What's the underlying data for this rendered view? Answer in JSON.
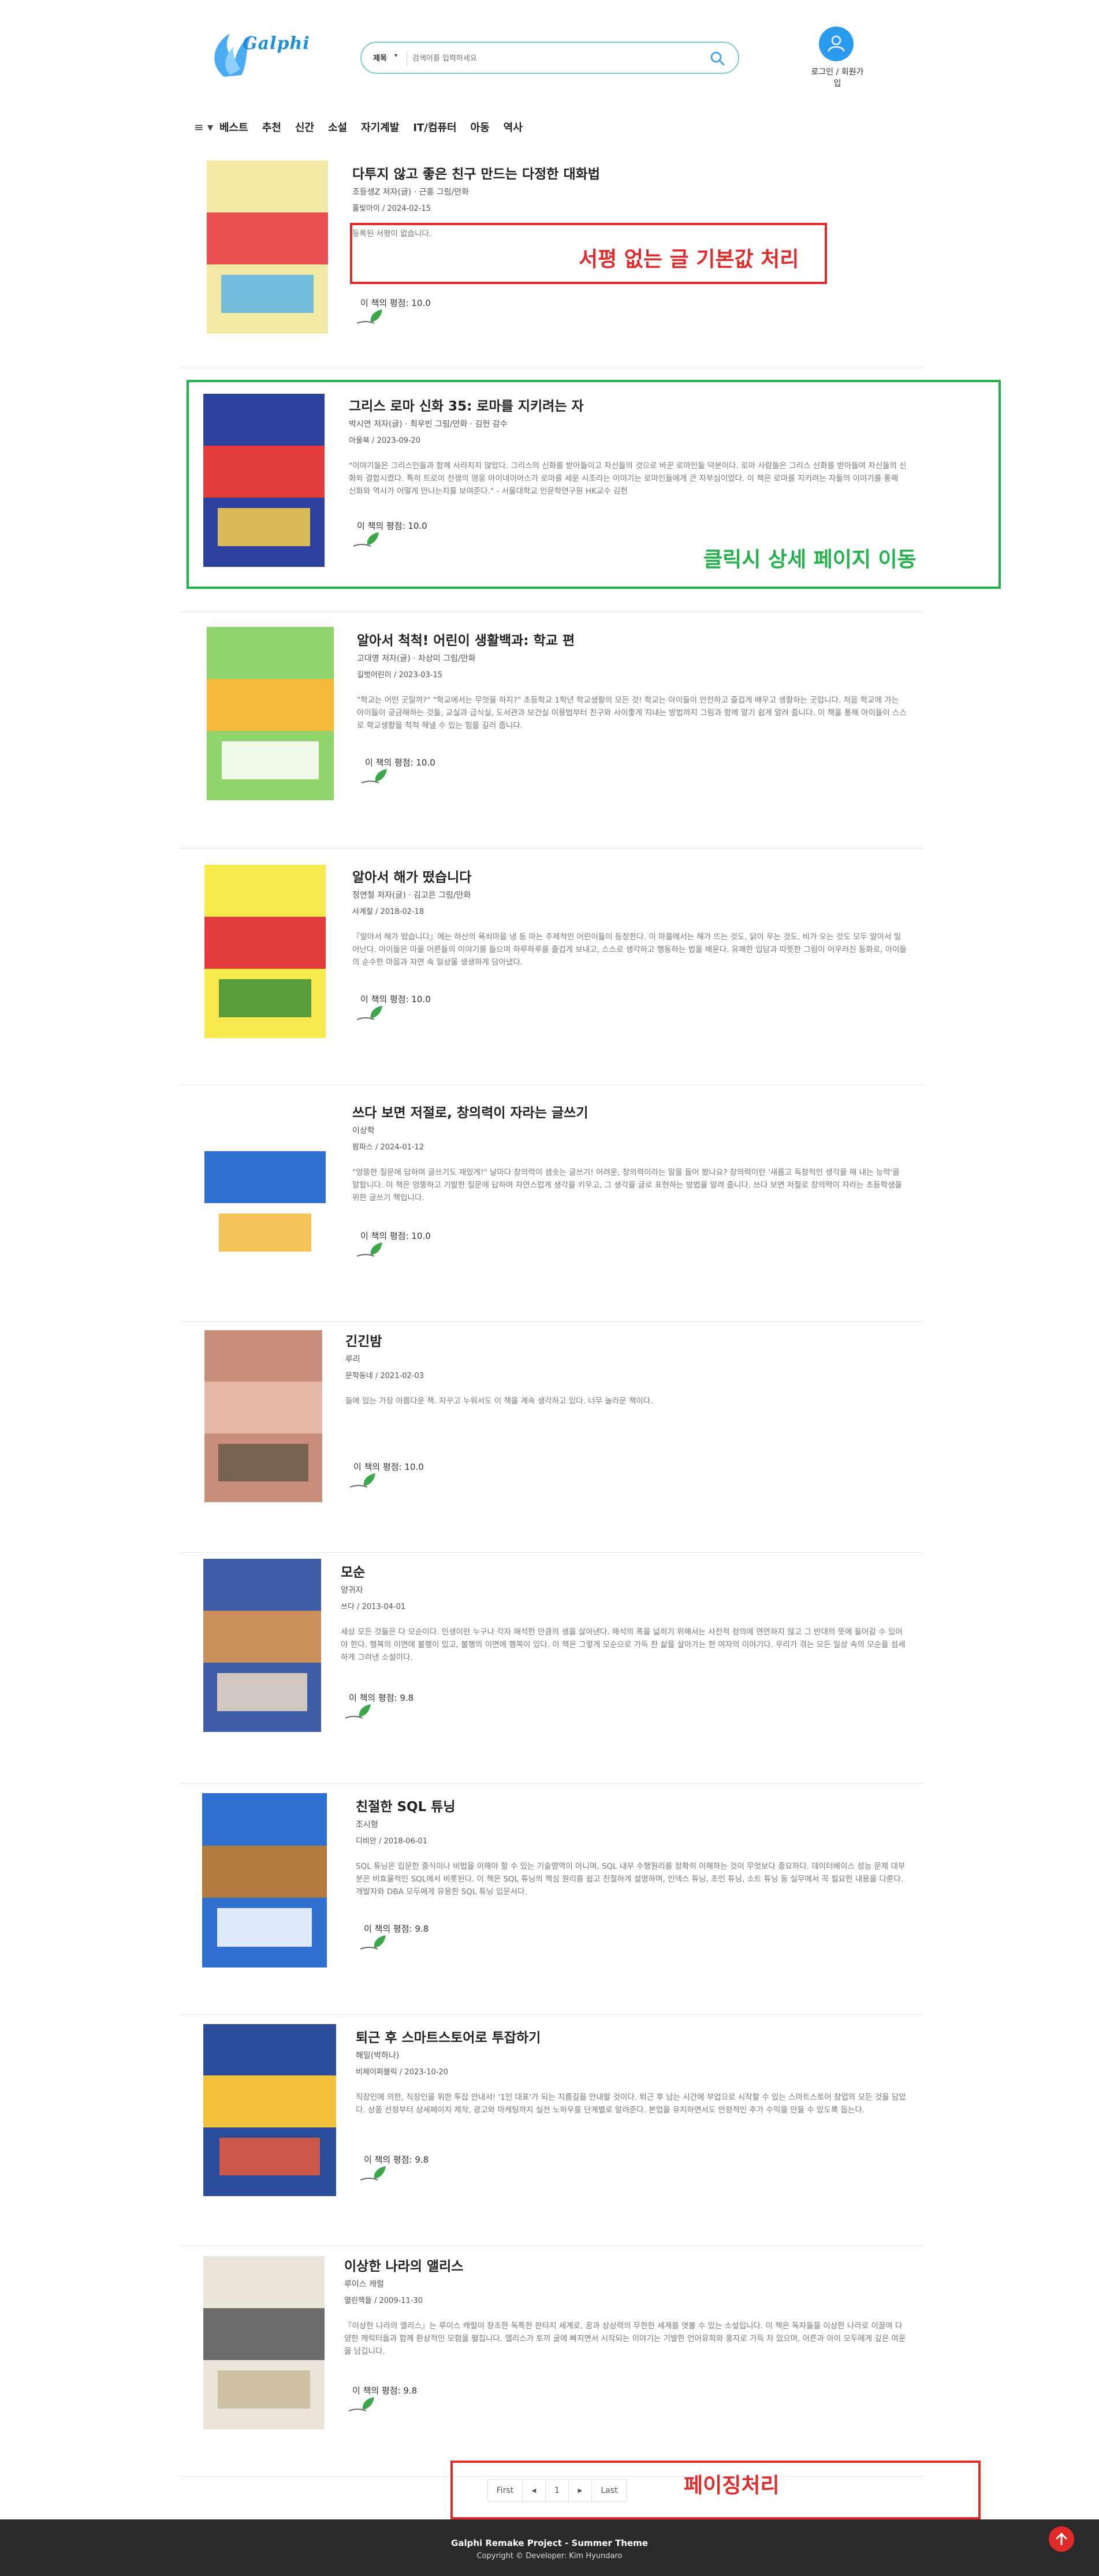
{
  "header": {
    "logo_text": "Galphi",
    "search": {
      "category": "제목",
      "placeholder": "검색어를 입력하세요"
    },
    "login_label": "로그인 / 회원가입"
  },
  "nav": {
    "items": [
      "베스트",
      "추천",
      "신간",
      "소설",
      "자기계발",
      "IT/컴퓨터",
      "아동",
      "역사"
    ]
  },
  "rating_prefix": "이 책의 평점: ",
  "books": [
    {
      "title": "다투지 않고 좋은 친구 만드는 다정한 대화법",
      "author": "조등생Z 저자(글) · 근홍 그림/만화",
      "publisher": "풀빛아이",
      "date": "2024-02-15",
      "description": "등록된 서평이 없습니다.",
      "rating": "10.0",
      "cover_colors": [
        "#f3e9a6",
        "#e84f4f",
        "#5cb6e6"
      ]
    },
    {
      "title": "그리스 로마 신화 35: 로마를 지키려는 자",
      "author": "박시연 저자(글) · 최우빈 그림/만화 · 김헌 감수",
      "publisher": "아울북",
      "date": "2023-09-20",
      "description": "\"이야기들은 그리스인들과 함께 사라지지 않았다. 그리스의 신화를 받아들이고 자신들의 것으로 바꾼 로마인들 덕분이다. 로마 사람들은 그리스 신화를 받아들여 자신들의 신화와 결합시켰다. 특히 트로이 전쟁의 영웅 아이네이아스가 로마를 세운 시조라는 이야기는 로마인들에게 큰 자부심이었다. 이 책은 로마를 지키려는 자들의 이야기를 통해 신화와 역사가 어떻게 만나는지를 보여준다.\" - 서울대학교 인문학연구원 HK교수 김헌",
      "rating": "10.0",
      "cover_colors": [
        "#2f3f9e",
        "#e23c3c",
        "#f6d14a"
      ]
    },
    {
      "title": "알아서 척척! 어린이 생활백과: 학교 편",
      "author": "고대영 저자(글) · 차상미 그림/만화",
      "publisher": "길벗어린이",
      "date": "2023-03-15",
      "description": "\"학교는 어떤 곳일까?\" \"학교에서는 무엇을 하지?\" 초등학교 1학년 학교생활의 모든 것! 학교는 아이들이 안전하고 즐겁게 배우고 생활하는 곳입니다. 처음 학교에 가는 아이들이 궁금해하는 것들, 교실과 급식실, 도서관과 보건실 이용법부터 친구와 사이좋게 지내는 방법까지 그림과 함께 알기 쉽게 알려 줍니다. 이 책을 통해 아이들이 스스로 학교생활을 척척 해낼 수 있는 힘을 길러 줍니다.",
      "rating": "10.0",
      "cover_colors": [
        "#8fd36b",
        "#f5b93b",
        "#ffffff"
      ]
    },
    {
      "title": "알아서 해가 떴습니다",
      "author": "정연철 저자(글) · 김고은 그림/만화",
      "publisher": "사계절",
      "date": "2018-02-18",
      "description": "『알아서 해가 떴습니다』에는 하산의 욕쇠마을 냉 동 마는 주제적인 어린이들이 등장한다. 이 마을에서는 해가 뜨는 것도, 닭이 우는 것도, 비가 오는 것도 모두 알아서 일어난다. 아이들은 마을 어른들의 이야기를 들으며 하루하루를 즐겁게 보내고, 스스로 생각하고 행동하는 법을 배운다. 유쾌한 입담과 따뜻한 그림이 어우러진 동화로, 아이들의 순수한 마음과 자연 속 일상을 생생하게 담아냈다.",
      "rating": "10.0",
      "cover_colors": [
        "#f7e84e",
        "#e23c3c",
        "#3e8e3a"
      ]
    },
    {
      "title": "쓰다 보면 저절로, 창의력이 자라는 글쓰기",
      "author": "이상학",
      "publisher": "팜파스",
      "date": "2024-01-12",
      "description": "\"엉뚱한 질문에 답하며 글쓰기도 재밌게!\" 날마다 창의력이 샘솟는 글쓰기! 어려운, 창의력이라는 말을 들어 봤나요? 창의력이란 '새롭고 독창적인 생각을 해 내는 능력'을 말합니다. 이 책은 엉뚱하고 기발한 질문에 답하며 자연스럽게 생각을 키우고, 그 생각을 글로 표현하는 방법을 알려 줍니다. 쓰다 보면 저절로 창의력이 자라는 초등학생을 위한 글쓰기 책입니다.",
      "rating": "10.0",
      "cover_colors": [
        "#ffffff",
        "#2f6fd0",
        "#f5b93b"
      ]
    },
    {
      "title": "긴긴밤",
      "author": "루리",
      "publisher": "문학동네",
      "date": "2021-02-03",
      "description": "들에 있는 가장 아름다운 책. 자꾸고 누워서도 이 책을 계속 생각하고 있다. 너무 놀라운 책이다.",
      "rating": "10.0",
      "cover_colors": [
        "#c98e7a",
        "#e6b8a6",
        "#6a5a4a"
      ]
    },
    {
      "title": "모순",
      "author": "양귀자",
      "publisher": "쓰다",
      "date": "2013-04-01",
      "description": "세상 모든 것들은 다 모순이다. 인생이란 누구나 각자 해석한 만큼의 생을 살아낸다. 해석의 폭을 넓히기 위해서는 사전적 정의에 연연하지 않고 그 반대의 뜻에 들어갈 수 있어야 한다. 행복의 이면에 불행이 있고, 불행의 이면에 행복이 있다. 이 책은 그렇게 모순으로 가득 찬 삶을 살아가는 한 여자의 이야기다. 우리가 겪는 모든 일상 속의 모순을 섬세하게 그려낸 소설이다.",
      "rating": "9.8",
      "cover_colors": [
        "#3f5ea7",
        "#c98e5a",
        "#e9d9c4"
      ]
    },
    {
      "title": "친절한 SQL 튜닝",
      "author": "조시형",
      "publisher": "디비안",
      "date": "2018-06-01",
      "description": "SQL 튜닝은 입문한 중식이나 비법을 이해야 할 수 있는 기술영역이 아니며, SQL 내부 수행원리를 정확히 이해하는 것이 무엇보다 중요하다. 데이터베이스 성능 문제 대부분은 비효율적인 SQL에서 비롯된다. 이 책은 SQL 튜닝의 핵심 원리를 쉽고 친절하게 설명하며, 인덱스 튜닝, 조인 튜닝, 소트 튜닝 등 실무에서 꼭 필요한 내용을 다룬다. 개발자와 DBA 모두에게 유용한 SQL 튜닝 입문서다.",
      "rating": "9.8",
      "cover_colors": [
        "#2f6fd0",
        "#b47a3c",
        "#ffffff"
      ]
    },
    {
      "title": "퇴근 후 스마트스토어로 투잡하기",
      "author": "해밀(박하나)",
      "publisher": "비제이퍼블릭",
      "date": "2023-10-20",
      "description": "직장인에 의한, 직장인을 위한 투잡 안내서! '1인 대표'가 되는 지름길을 안내할 것이다. 퇴근 후 남는 시간에 부업으로 시작할 수 있는 스마트스토어 창업의 모든 것을 담았다. 상품 선정부터 상세페이지 제작, 광고와 마케팅까지 실전 노하우를 단계별로 알려준다. 본업을 유지하면서도 안정적인 추가 수익을 만들 수 있도록 돕는다.",
      "rating": "9.8",
      "cover_colors": [
        "#2b4d9a",
        "#f5c33b",
        "#e85a3c"
      ]
    },
    {
      "title": "이상한 나라의 앨리스",
      "author": "루이스 캐럴",
      "publisher": "열린책들",
      "date": "2009-11-30",
      "description": "『이상한 나라의 앨리스』는 루이스 캐럴이 창조한 독특한 판타지 세계로, 꿈과 상상력의 무한한 세계를 엿볼 수 있는 소설입니다. 이 책은 독자들을 이상한 나라로 이끌며 다양한 캐릭터들과 함께 환상적인 모험을 펼칩니다. 앨리스가 토끼 굴에 빠지면서 시작되는 이야기는 기발한 언어유희와 풍자로 가득 차 있으며, 어른과 아이 모두에게 깊은 여운을 남깁니다.",
      "rating": "9.8",
      "cover_colors": [
        "#ece6da",
        "#6b6b6b",
        "#c9b89a"
      ]
    }
  ],
  "annotations": {
    "default_review": "서평 없는 글 기본값 처리",
    "detail_nav": "클릭시 상세 페이지 이동",
    "pagination": "페이징처리"
  },
  "pagination": {
    "first": "First",
    "prev": "◀",
    "current": "1",
    "next": "▶",
    "last": "Last"
  },
  "footer": {
    "title": "Galphi Remake Project - Summer Theme",
    "copyright": "Copyright © Developer: Kim Hyundaro"
  },
  "colors": {
    "accent": "#2b9bf0",
    "annotation_red": "#e02b2b",
    "annotation_green": "#22b24c",
    "footer_bg": "#2a2a2a"
  }
}
